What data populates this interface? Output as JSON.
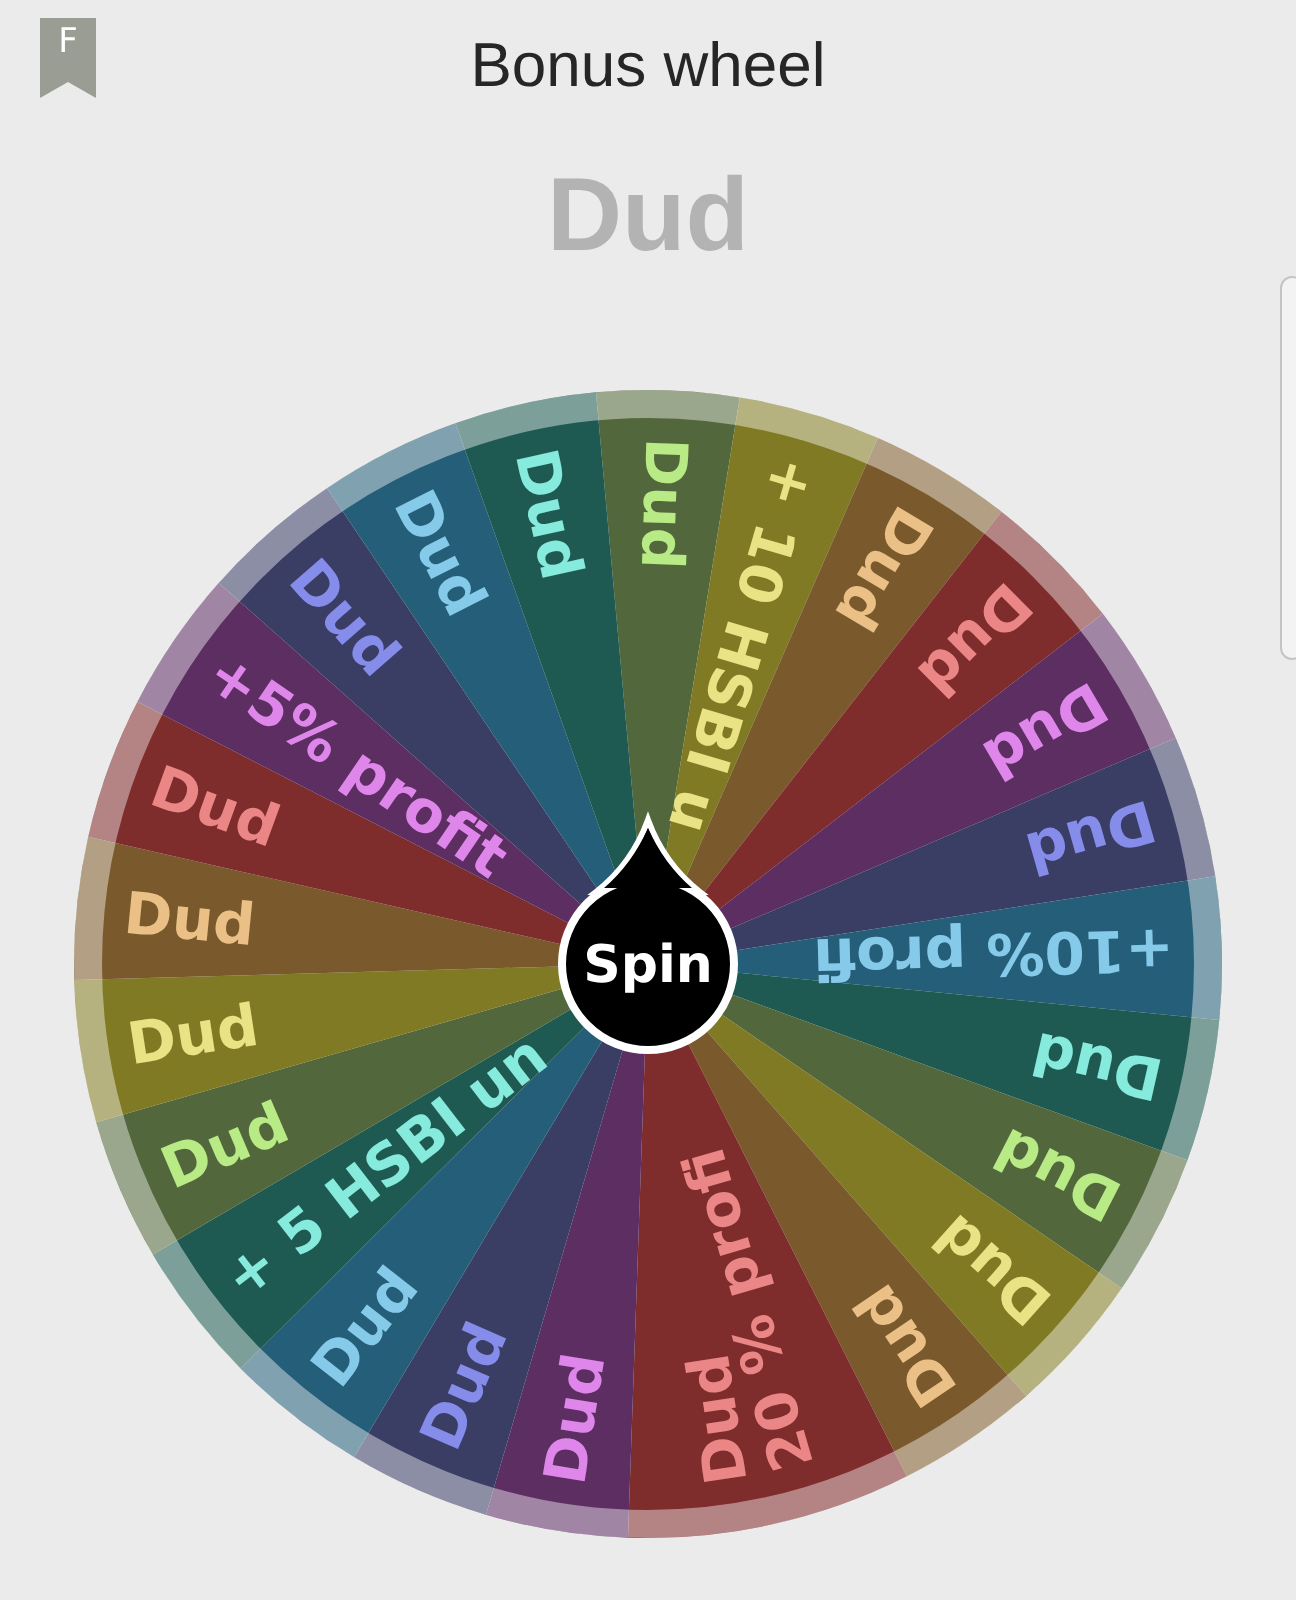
{
  "header": {
    "badge_letter": "F",
    "title": "Bonus wheel"
  },
  "result": "Dud",
  "wheel": {
    "spin_label": "Spin",
    "segments": [
      {
        "color": "#52683c",
        "labels": [
          "Dud"
        ]
      },
      {
        "color": "#807a24",
        "labels": [
          "+ 10 HSBI u"
        ]
      },
      {
        "color": "#7a5a2c",
        "labels": [
          "Dud"
        ]
      },
      {
        "color": "#7e2c2c",
        "labels": [
          "Dud"
        ]
      },
      {
        "color": "#5c2e62",
        "labels": [
          "Dud"
        ]
      },
      {
        "color": "#3a3d64",
        "labels": [
          "Dud"
        ]
      },
      {
        "color": "#255e78",
        "labels": [
          "+10% profi"
        ]
      },
      {
        "color": "#1f5a52",
        "labels": [
          "Dud"
        ]
      },
      {
        "color": "#52683c",
        "labels": [
          "Dud"
        ]
      },
      {
        "color": "#807a24",
        "labels": [
          "Dud"
        ]
      },
      {
        "color": "#7a5a2c",
        "labels": [
          "Dud"
        ]
      },
      {
        "color": "#7e2c2c",
        "labels": [
          "Dud",
          "20 % profi"
        ]
      },
      {
        "color": "#5c2e62",
        "labels": [
          "Dud"
        ]
      },
      {
        "color": "#3a3d64",
        "labels": [
          "Dud"
        ]
      },
      {
        "color": "#255e78",
        "labels": [
          "Dud"
        ]
      },
      {
        "color": "#1f5a52",
        "labels": [
          "+ 5 HSBI un"
        ]
      },
      {
        "color": "#52683c",
        "labels": [
          "Dud"
        ]
      },
      {
        "color": "#807a24",
        "labels": [
          "Dud"
        ]
      },
      {
        "color": "#7a5a2c",
        "labels": [
          "Dud"
        ]
      },
      {
        "color": "#7e2c2c",
        "labels": [
          "Dud"
        ]
      },
      {
        "color": "#5c2e62",
        "labels": [
          "+5% profit"
        ]
      },
      {
        "color": "#3a3d64",
        "labels": [
          "Dud"
        ]
      },
      {
        "color": "#255e78",
        "labels": [
          "Dud"
        ]
      },
      {
        "color": "#1f5a52",
        "labels": [
          "Dud"
        ]
      }
    ]
  }
}
